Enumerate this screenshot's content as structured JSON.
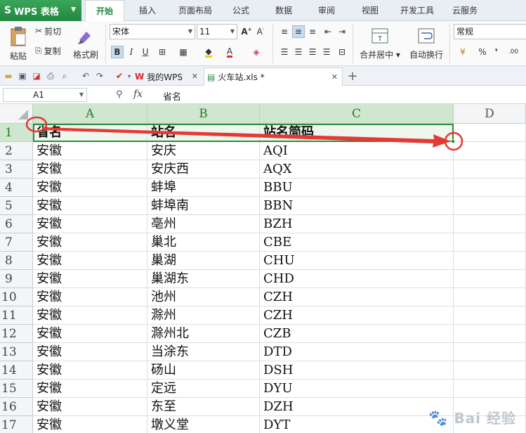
{
  "app": {
    "name": "WPS 表格",
    "logo": "S"
  },
  "menu": [
    "开始",
    "插入",
    "页面布局",
    "公式",
    "数据",
    "审阅",
    "视图",
    "开发工具",
    "云服务"
  ],
  "ribbon": {
    "paste": "粘贴",
    "cut": "剪切",
    "copy": "复制",
    "format_painter": "格式刷",
    "font_name": "宋体",
    "font_size": "11",
    "bold": "B",
    "italic": "I",
    "underline": "U",
    "merge_center": "合并居中",
    "wrap_text": "自动换行",
    "number_format": "常规",
    "percent": "%",
    "comma": "❜"
  },
  "tabs": {
    "my_wps": "我的WPS",
    "file_tab": "火车站.xls *"
  },
  "formula_bar": {
    "cell_ref": "A1",
    "fx": "fx",
    "content": "省名"
  },
  "columns": [
    "A",
    "B",
    "C",
    "D"
  ],
  "rows": [
    {
      "n": "1",
      "a": "省名",
      "b": "站名",
      "c": "站名简码"
    },
    {
      "n": "2",
      "a": "安徽",
      "b": "安庆",
      "c": "AQI"
    },
    {
      "n": "3",
      "a": "安徽",
      "b": "安庆西",
      "c": "AQX"
    },
    {
      "n": "4",
      "a": "安徽",
      "b": "蚌埠",
      "c": "BBU"
    },
    {
      "n": "5",
      "a": "安徽",
      "b": "蚌埠南",
      "c": "BBN"
    },
    {
      "n": "6",
      "a": "安徽",
      "b": "亳州",
      "c": "BZH"
    },
    {
      "n": "7",
      "a": "安徽",
      "b": "巢北",
      "c": "CBE"
    },
    {
      "n": "8",
      "a": "安徽",
      "b": "巢湖",
      "c": "CHU"
    },
    {
      "n": "9",
      "a": "安徽",
      "b": "巢湖东",
      "c": "CHD"
    },
    {
      "n": "10",
      "a": "安徽",
      "b": "池州",
      "c": "CZH"
    },
    {
      "n": "11",
      "a": "安徽",
      "b": "滁州",
      "c": "CZH"
    },
    {
      "n": "12",
      "a": "安徽",
      "b": "滁州北",
      "c": "CZB"
    },
    {
      "n": "13",
      "a": "安徽",
      "b": "当涂东",
      "c": "DTD"
    },
    {
      "n": "14",
      "a": "安徽",
      "b": "砀山",
      "c": "DSH"
    },
    {
      "n": "15",
      "a": "安徽",
      "b": "定远",
      "c": "DYU"
    },
    {
      "n": "16",
      "a": "安徽",
      "b": "东至",
      "c": "DZH"
    },
    {
      "n": "17",
      "a": "安徽",
      "b": "墩义堂",
      "c": "DYT"
    }
  ],
  "watermark": "Bai 经验",
  "colors": {
    "accent": "#21883f",
    "selection": "#2f8a3a",
    "annotation": "#e53935"
  }
}
